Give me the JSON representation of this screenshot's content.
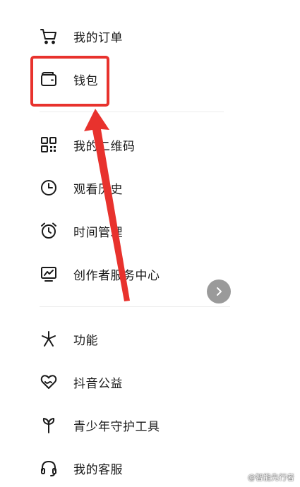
{
  "menu": {
    "orders": "我的订单",
    "wallet": "钱包",
    "qrcode": "我的二维码",
    "history": "观看历史",
    "time_manage": "时间管理",
    "creator_center": "创作者服务中心",
    "features": "功能",
    "charity": "抖音公益",
    "youth": "青少年守护工具",
    "service": "我的客服"
  },
  "watermark": "@智能先行者",
  "colors": {
    "highlight": "#e8322d",
    "text": "#1a1a1a",
    "divider": "#ececec"
  }
}
